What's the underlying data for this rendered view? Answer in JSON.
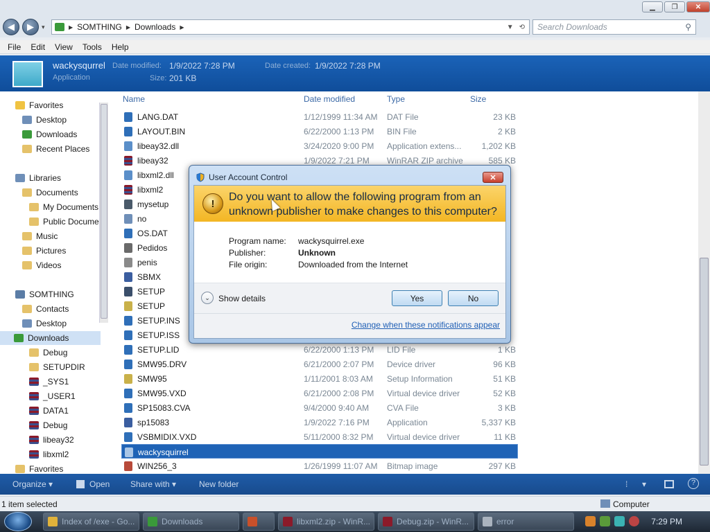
{
  "address": {
    "crumbs": [
      "SOMTHING",
      "Downloads"
    ],
    "search_placeholder": "Search Downloads"
  },
  "menu": [
    "File",
    "Edit",
    "View",
    "Tools",
    "Help"
  ],
  "details": {
    "name": "wackysqurrel",
    "subtitle": "Application",
    "date_modified_label": "Date modified:",
    "date_modified": "1/9/2022 7:28 PM",
    "date_created_label": "Date created:",
    "date_created": "1/9/2022 7:28 PM",
    "size_label": "Size:",
    "size": "201 KB"
  },
  "nav": [
    {
      "label": "Favorites",
      "icon": "star-icon"
    },
    {
      "label": "Desktop",
      "icon": "desktop-icon"
    },
    {
      "label": "Downloads",
      "icon": "downloads-icon"
    },
    {
      "label": "Recent Places",
      "icon": "recent-icon"
    },
    {
      "label": "Libraries",
      "icon": "library-icon"
    },
    {
      "label": "Documents",
      "icon": "documents-icon"
    },
    {
      "label": "My Documents",
      "icon": "folder-icon"
    },
    {
      "label": "Public Docume",
      "icon": "folder-icon"
    },
    {
      "label": "Music",
      "icon": "music-icon"
    },
    {
      "label": "Pictures",
      "icon": "pictures-icon"
    },
    {
      "label": "Videos",
      "icon": "videos-icon"
    },
    {
      "label": "SOMTHING",
      "icon": "user-icon"
    },
    {
      "label": "Contacts",
      "icon": "contacts-icon"
    },
    {
      "label": "Desktop",
      "icon": "desktop-icon"
    },
    {
      "label": "Downloads",
      "icon": "downloads-icon"
    },
    {
      "label": "Debug",
      "icon": "folder-icon"
    },
    {
      "label": "SETUPDIR",
      "icon": "folder-icon"
    },
    {
      "label": "_SYS1",
      "icon": "rar-icon"
    },
    {
      "label": "_USER1",
      "icon": "rar-icon"
    },
    {
      "label": "DATA1",
      "icon": "rar-icon"
    },
    {
      "label": "Debug",
      "icon": "rar-icon"
    },
    {
      "label": "libeay32",
      "icon": "rar-icon"
    },
    {
      "label": "libxml2",
      "icon": "rar-icon"
    },
    {
      "label": "Favorites",
      "icon": "folder-icon"
    }
  ],
  "columns": {
    "name": "Name",
    "date": "Date modified",
    "type": "Type",
    "size": "Size"
  },
  "files": [
    {
      "name": "LANG.DAT",
      "date": "1/12/1999 11:34 AM",
      "type": "DAT File",
      "size": "23 KB"
    },
    {
      "name": "LAYOUT.BIN",
      "date": "6/22/2000 1:13 PM",
      "type": "BIN File",
      "size": "2 KB"
    },
    {
      "name": "libeay32.dll",
      "date": "3/24/2020 9:00 PM",
      "type": "Application extens...",
      "size": "1,202 KB"
    },
    {
      "name": "libeay32",
      "date": "1/9/2022 7:21 PM",
      "type": "WinRAR ZIP archive",
      "size": "585 KB"
    },
    {
      "name": "libxml2.dll",
      "date": "",
      "type": "",
      "size": ""
    },
    {
      "name": "libxml2",
      "date": "",
      "type": "",
      "size": ""
    },
    {
      "name": "mysetup",
      "date": "",
      "type": "",
      "size": ""
    },
    {
      "name": "no",
      "date": "",
      "type": "",
      "size": ""
    },
    {
      "name": "OS.DAT",
      "date": "",
      "type": "",
      "size": ""
    },
    {
      "name": "Pedidos",
      "date": "",
      "type": "",
      "size": ""
    },
    {
      "name": "penis",
      "date": "",
      "type": "",
      "size": ""
    },
    {
      "name": "SBMX",
      "date": "",
      "type": "",
      "size": ""
    },
    {
      "name": "SETUP",
      "date": "",
      "type": "",
      "size": ""
    },
    {
      "name": "SETUP",
      "date": "",
      "type": "",
      "size": ""
    },
    {
      "name": "SETUP.INS",
      "date": "",
      "type": "",
      "size": ""
    },
    {
      "name": "SETUP.ISS",
      "date": "",
      "type": "",
      "size": ""
    },
    {
      "name": "SETUP.LID",
      "date": "6/22/2000 1:13 PM",
      "type": "LID File",
      "size": "1 KB"
    },
    {
      "name": "SMW95.DRV",
      "date": "6/21/2000 2:07 PM",
      "type": "Device driver",
      "size": "96 KB"
    },
    {
      "name": "SMW95",
      "date": "1/11/2001 8:03 AM",
      "type": "Setup Information",
      "size": "51 KB"
    },
    {
      "name": "SMW95.VXD",
      "date": "6/21/2000 2:08 PM",
      "type": "Virtual device driver",
      "size": "52 KB"
    },
    {
      "name": "SP15083.CVA",
      "date": "9/4/2000 9:40 AM",
      "type": "CVA File",
      "size": "3 KB"
    },
    {
      "name": "sp15083",
      "date": "1/9/2022 7:16 PM",
      "type": "Application",
      "size": "5,337 KB"
    },
    {
      "name": "VSBMIDIX.VXD",
      "date": "5/11/2000 8:32 PM",
      "type": "Virtual device driver",
      "size": "11 KB"
    },
    {
      "name": "wackysquirrel",
      "date": "",
      "type": "",
      "size": ""
    },
    {
      "name": "WIN256_3",
      "date": "1/26/1999 11:07 AM",
      "type": "Bitmap image",
      "size": "297 KB"
    }
  ],
  "cmdbar": {
    "organize": "Organize ▾",
    "open": "Open",
    "share": "Share with ▾",
    "new_folder": "New folder"
  },
  "status": {
    "left": "1 item selected",
    "right": "Computer"
  },
  "taskbar": {
    "items": [
      "Index of /exe - Go...",
      "Downloads",
      "",
      "libxml2.zip - WinR...",
      "Debug.zip - WinR...",
      "error"
    ],
    "clock": "7:29 PM"
  },
  "uac": {
    "title": "User Account Control",
    "question": "Do you want to allow the following program from an unknown publisher to make changes to this computer?",
    "program_label": "Program name:",
    "program_value": "wackysquirrel.exe",
    "publisher_label": "Publisher:",
    "publisher_value": "Unknown",
    "origin_label": "File origin:",
    "origin_value": "Downloaded from the Internet",
    "show_details": "Show details",
    "yes": "Yes",
    "no": "No",
    "change_link": "Change when these notifications appear"
  }
}
